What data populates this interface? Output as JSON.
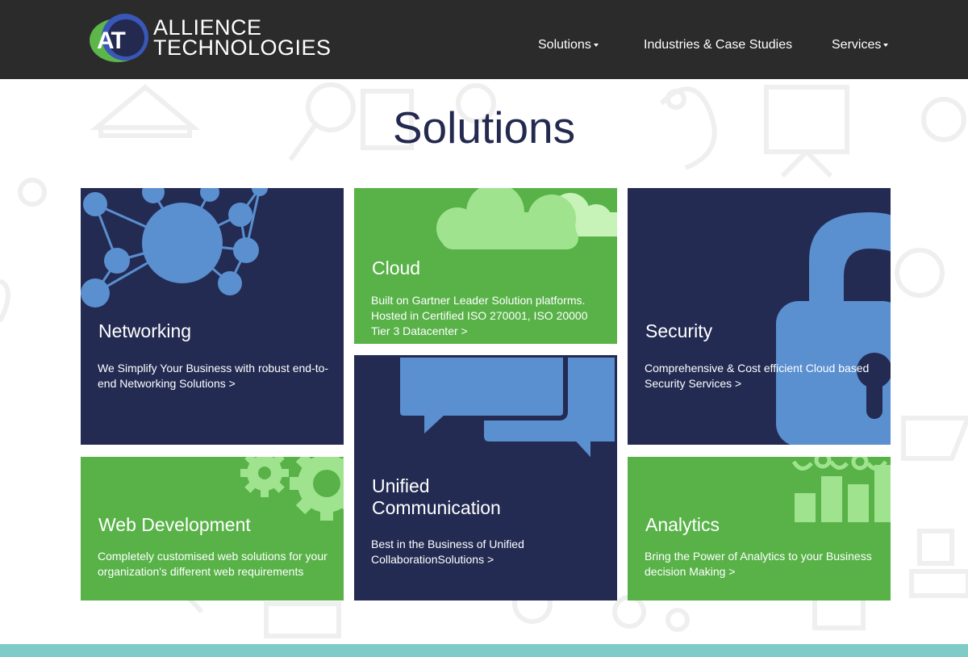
{
  "brand": {
    "logo_initials": "AT",
    "name_line1": "ALLIENCE",
    "name_line2": "TECHNOLOGIES"
  },
  "nav": {
    "solutions": "Solutions",
    "industries": "Industries & Case Studies",
    "services": "Services"
  },
  "page": {
    "title": "Solutions"
  },
  "tiles": {
    "networking": {
      "title": "Networking",
      "desc": "We Simplify Your Business with robust end-to-end Networking Solutions >"
    },
    "cloud": {
      "title": "Cloud",
      "desc": "Built on Gartner Leader Solution platforms. Hosted in Certified ISO 270001, ISO 20000 Tier 3 Datacenter >"
    },
    "security": {
      "title": "Security",
      "desc": "Comprehensive & Cost efficient Cloud based Security Services >"
    },
    "web_development": {
      "title": "Web Development",
      "desc": "Completely customised web solutions for your organization's different web requirements"
    },
    "unified_communication": {
      "title_line1": "Unified",
      "title_line2": "Communication",
      "desc": "Best in the Business of Unified CollaborationSolutions >"
    },
    "analytics": {
      "title": "Analytics",
      "desc": "Bring the Power of Analytics to your Business decision Making >"
    }
  },
  "colors": {
    "header_bg": "#2b2b2b",
    "navy": "#232b52",
    "green": "#58b248",
    "accent_blue": "#5a8fd0",
    "title_color": "#23294f",
    "footer_teal": "#7ecbc7"
  },
  "icons": [
    "network-graph-icon",
    "cloud-icon",
    "padlock-icon",
    "gears-icon",
    "chat-bubbles-icon",
    "bar-chart-icon"
  ]
}
